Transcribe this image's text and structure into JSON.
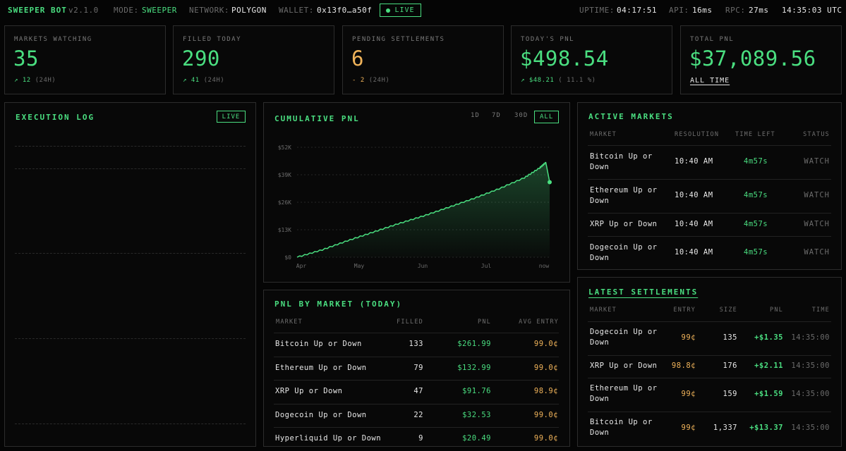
{
  "topbar": {
    "brand": "SWEEPER BOT",
    "version": "v2.1.0",
    "mode_label": "MODE:",
    "mode_value": "SWEEPER",
    "network_label": "NETWORK:",
    "network_value": "POLYGON",
    "wallet_label": "WALLET:",
    "wallet_value": "0x13f0…a50f",
    "live_label": "LIVE",
    "uptime_label": "UPTIME:",
    "uptime_value": "04:17:51",
    "api_label": "API:",
    "api_value": "16ms",
    "rpc_label": "RPC:",
    "rpc_value": "27ms",
    "clock": "14:35:03 UTC"
  },
  "stats": [
    {
      "label": "MARKETS WATCHING",
      "value": "35",
      "delta_arrow": "↗",
      "delta_value": "12",
      "delta_note": "(24H)"
    },
    {
      "label": "FILLED TODAY",
      "value": "290",
      "delta_arrow": "↗",
      "delta_value": "41",
      "delta_note": "(24H)"
    },
    {
      "label": "PENDING SETTLEMENTS",
      "value": "6",
      "delta_arrow": "-",
      "delta_value": "2",
      "delta_note": "(24H)"
    },
    {
      "label": "TODAY'S PNL",
      "value": "$498.54",
      "delta_arrow": "↗",
      "delta_value": "$48.21",
      "delta_note": "( 11.1 %)"
    },
    {
      "label": "TOTAL PNL",
      "value": "$37,089.56",
      "footer": "ALL TIME"
    }
  ],
  "execution_log": {
    "title": "EXECUTION LOG",
    "live_label": "LIVE"
  },
  "cumulative": {
    "title": "CUMULATIVE PNL",
    "ranges": [
      "1D",
      "7D",
      "30D",
      "ALL"
    ],
    "active_range": "ALL"
  },
  "chart_data": {
    "type": "area",
    "title": "CUMULATIVE PNL",
    "y_ticks": [
      "$0",
      "$13K",
      "$26K",
      "$39K",
      "$52K"
    ],
    "x_ticks": [
      "Apr",
      "May",
      "Jun",
      "Jul",
      "now"
    ],
    "ylim": [
      0,
      52000
    ],
    "x": [
      0,
      0.1,
      0.2,
      0.3,
      0.4,
      0.5,
      0.6,
      0.7,
      0.8,
      0.9,
      0.96,
      0.985,
      1.0
    ],
    "values": [
      0,
      3500,
      7800,
      11800,
      15800,
      19500,
      23600,
      27800,
      32400,
      37600,
      42200,
      44800,
      35500
    ],
    "grid": true
  },
  "pnl_by_market": {
    "title": "PNL BY MARKET (TODAY)",
    "columns": [
      "MARKET",
      "FILLED",
      "PNL",
      "AVG ENTRY"
    ],
    "rows": [
      {
        "market": "Bitcoin Up or Down",
        "filled": "133",
        "pnl": "$261.99",
        "avg_entry": "99.0¢"
      },
      {
        "market": "Ethereum Up or Down",
        "filled": "79",
        "pnl": "$132.99",
        "avg_entry": "99.0¢"
      },
      {
        "market": "XRP Up or Down",
        "filled": "47",
        "pnl": "$91.76",
        "avg_entry": "98.9¢"
      },
      {
        "market": "Dogecoin Up or Down",
        "filled": "22",
        "pnl": "$32.53",
        "avg_entry": "99.0¢"
      },
      {
        "market": "Hyperliquid Up or Down",
        "filled": "9",
        "pnl": "$20.49",
        "avg_entry": "99.0¢"
      }
    ]
  },
  "active_markets": {
    "title": "ACTIVE MARKETS",
    "columns": [
      "MARKET",
      "RESOLUTION",
      "TIME LEFT",
      "STATUS"
    ],
    "rows": [
      {
        "market_l1": "Bitcoin Up or",
        "market_l2": "Down",
        "resolution": "10:40 AM",
        "time_left": "4m57s",
        "status": "WATCH"
      },
      {
        "market_l1": "Ethereum Up or",
        "market_l2": "Down",
        "resolution": "10:40 AM",
        "time_left": "4m57s",
        "status": "WATCH"
      },
      {
        "market_l1": "XRP Up or Down",
        "market_l2": "",
        "resolution": "10:40 AM",
        "time_left": "4m57s",
        "status": "WATCH"
      },
      {
        "market_l1": "Dogecoin Up or",
        "market_l2": "Down",
        "resolution": "10:40 AM",
        "time_left": "4m57s",
        "status": "WATCH"
      }
    ]
  },
  "settlements": {
    "title": "LATEST SETTLEMENTS",
    "columns": [
      "MARKET",
      "ENTRY",
      "SIZE",
      "PNL",
      "TIME"
    ],
    "rows": [
      {
        "market_l1": "Dogecoin Up or",
        "market_l2": "Down",
        "entry": "99¢",
        "size": "135",
        "pnl": "+$1.35",
        "time": "14:35:00"
      },
      {
        "market_l1": "XRP Up or Down",
        "market_l2": "",
        "entry": "98.8¢",
        "size": "176",
        "pnl": "+$2.11",
        "time": "14:35:00"
      },
      {
        "market_l1": "Ethereum Up or",
        "market_l2": "Down",
        "entry": "99¢",
        "size": "159",
        "pnl": "+$1.59",
        "time": "14:35:00"
      },
      {
        "market_l1": "Bitcoin Up or",
        "market_l2": "Down",
        "entry": "99¢",
        "size": "1,337",
        "pnl": "+$13.37",
        "time": "14:35:00"
      }
    ]
  },
  "colors": {
    "accent": "#4ade80",
    "warn": "#f0b35a",
    "border": "#2c2c2c",
    "bg": "#050505"
  }
}
